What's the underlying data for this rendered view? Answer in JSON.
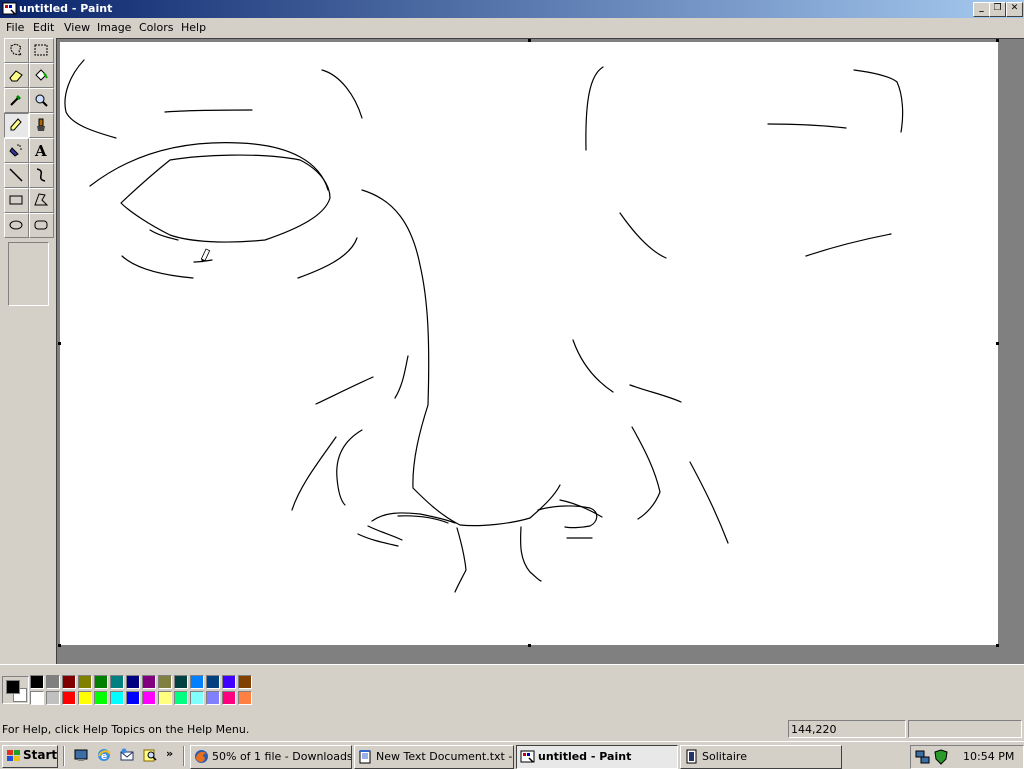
{
  "window": {
    "title": "untitled - Paint"
  },
  "menu": {
    "items": [
      "File",
      "Edit",
      "View",
      "Image",
      "Colors",
      "Help"
    ]
  },
  "toolbox": {
    "tools": [
      "free-form-select",
      "select",
      "eraser",
      "fill-with-color",
      "pick-color",
      "magnifier",
      "pencil",
      "brush",
      "airbrush",
      "text",
      "line",
      "curve",
      "rectangle",
      "polygon",
      "ellipse",
      "rounded-rectangle"
    ],
    "active": "pencil"
  },
  "palette": {
    "foreground": "#000000",
    "background": "#ffffff",
    "colors_top": [
      "#000000",
      "#808080",
      "#800000",
      "#808000",
      "#008000",
      "#008080",
      "#000080",
      "#800080",
      "#808040",
      "#004040",
      "#0080ff",
      "#004080",
      "#4000ff",
      "#804000"
    ],
    "colors_bottom": [
      "#ffffff",
      "#c0c0c0",
      "#ff0000",
      "#ffff00",
      "#00ff00",
      "#00ffff",
      "#0000ff",
      "#ff00ff",
      "#ffff80",
      "#00ff80",
      "#80ffff",
      "#8080ff",
      "#ff0080",
      "#ff8040"
    ]
  },
  "status": {
    "help_text": "For Help, click Help Topics on the Help Menu.",
    "coordinates": "144,220"
  },
  "taskbar": {
    "start_label": "Start",
    "tasks": [
      {
        "label": "50% of 1 file - Downloads",
        "icon": "firefox-icon"
      },
      {
        "label": "New Text Document.txt -...",
        "icon": "notepad-icon"
      },
      {
        "label": "untitled - Paint",
        "icon": "paint-icon",
        "active": true
      },
      {
        "label": "Solitaire",
        "icon": "solitaire-icon"
      }
    ],
    "clock": "10:54 PM"
  }
}
